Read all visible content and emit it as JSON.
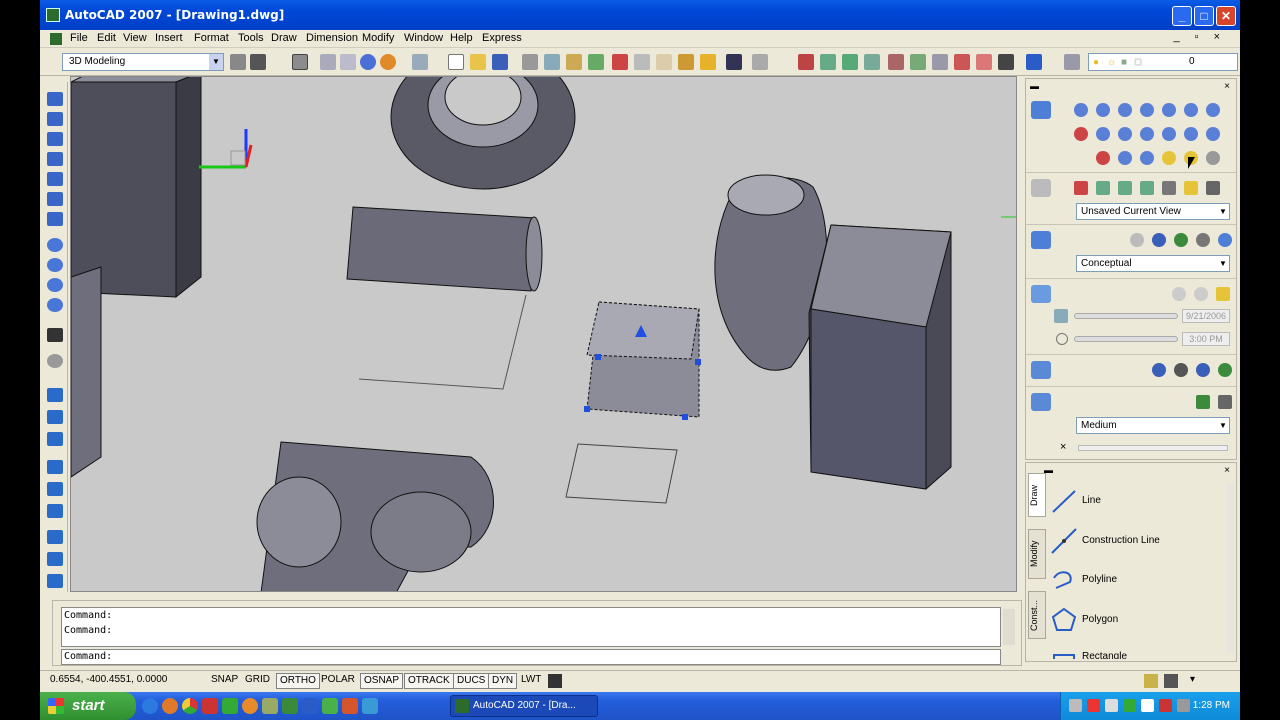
{
  "window": {
    "title": "AutoCAD 2007 - [Drawing1.dwg]",
    "min": "_",
    "max": "□",
    "close": "✕"
  },
  "menu": {
    "items": [
      "File",
      "Edit",
      "View",
      "Insert",
      "Format",
      "Tools",
      "Draw",
      "Dimension",
      "Modify",
      "Window",
      "Help",
      "Express"
    ],
    "doc_controls": "_ ▫ ×"
  },
  "toolbar": {
    "workspace": "3D Modeling",
    "layer_value": "0"
  },
  "dashboard": {
    "named_view": "Unsaved Current View",
    "visual_style": "Conceptual",
    "sun_date": "9/21/2006",
    "sun_time": "3:00 PM",
    "render_preset": "Medium"
  },
  "tool_palette": {
    "tabs": [
      "Draw",
      "Modify",
      "Const..."
    ],
    "items": [
      "Line",
      "Construction Line",
      "Polyline",
      "Polygon",
      "Rectangle"
    ]
  },
  "command": {
    "history": [
      "Command:",
      "Command:"
    ],
    "prompt": "Command:"
  },
  "status": {
    "coords": "0.6554, -400.4551, 0.0000",
    "toggles": [
      "SNAP",
      "GRID",
      "ORTHO",
      "POLAR",
      "OSNAP",
      "OTRACK",
      "DUCS",
      "DYN",
      "LWT"
    ]
  },
  "taskbar": {
    "start": "start",
    "task": "AutoCAD 2007 - [Dra...",
    "clock": "1:28 PM"
  },
  "colors": {
    "title_blue": "#0046d6",
    "viewport_bg": "#c9c9c9",
    "solid_dark": "#4a4a56",
    "solid_mid": "#6e6e7c",
    "solid_light": "#9a9aa6",
    "grip_blue": "#1f4fe0"
  }
}
